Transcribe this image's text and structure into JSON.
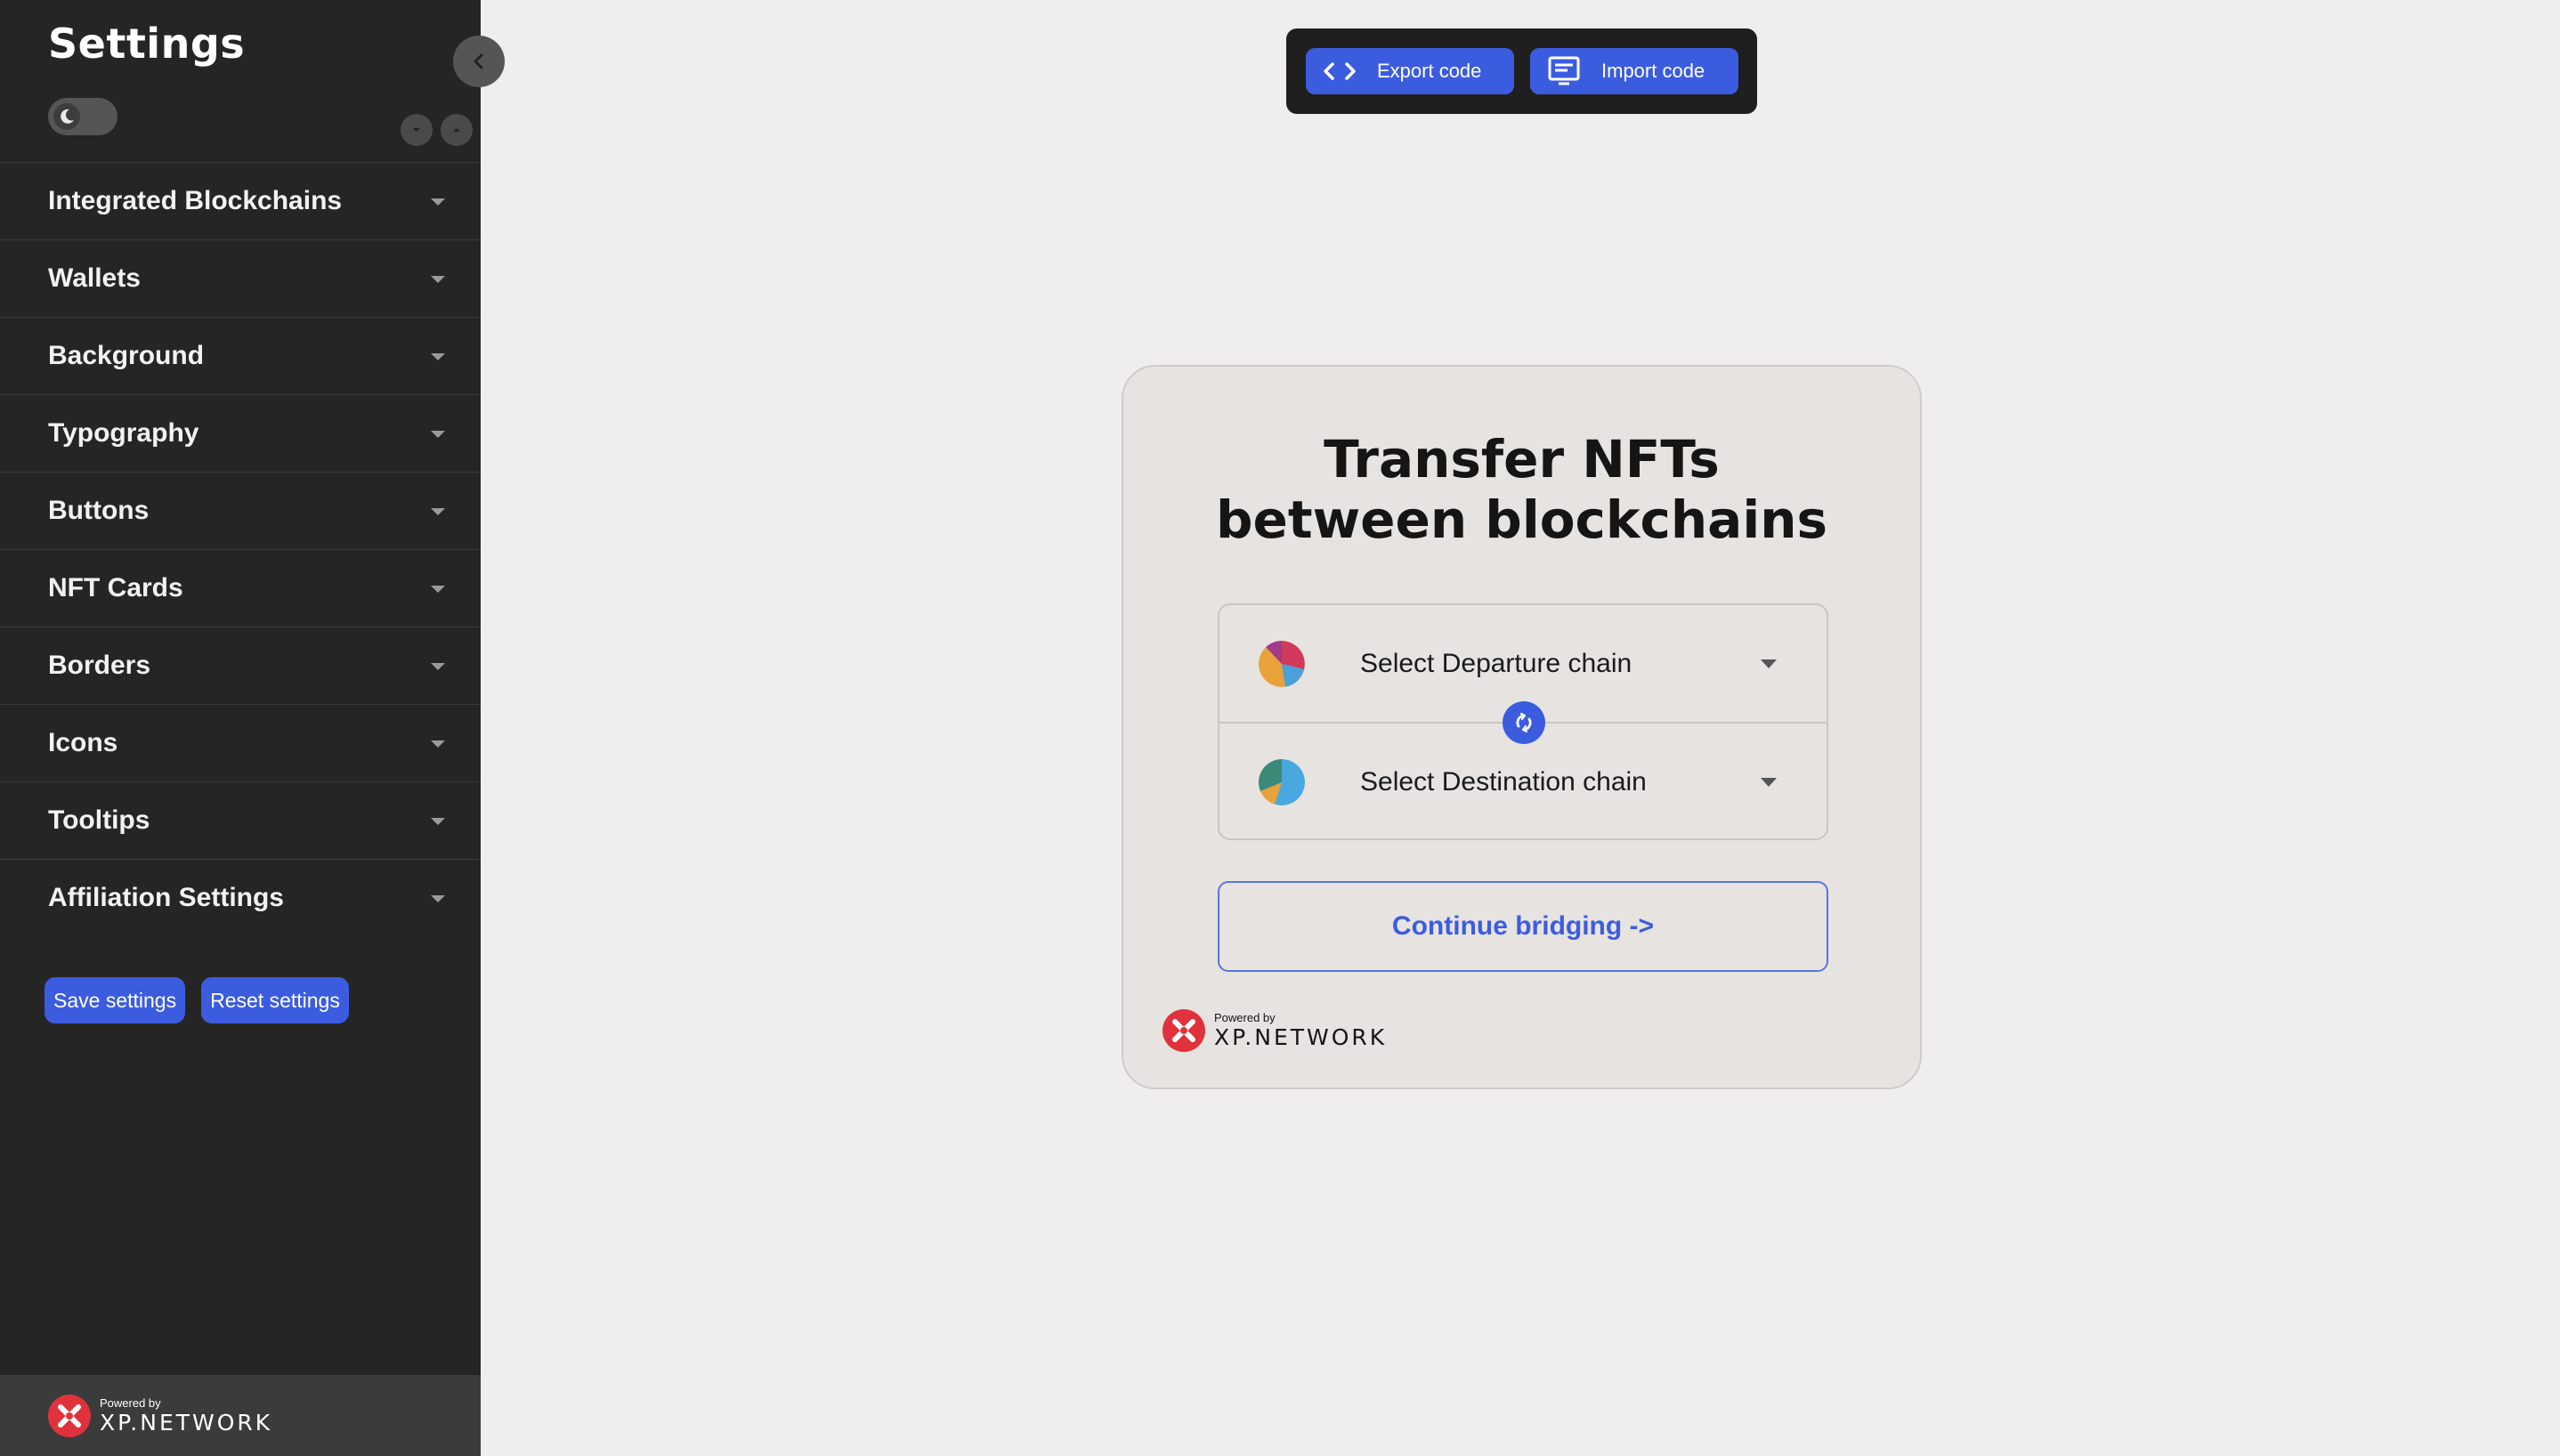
{
  "sidebar": {
    "title": "Settings",
    "theme_toggle_icon": "moon-icon",
    "items": [
      {
        "label": "Integrated Blockchains"
      },
      {
        "label": "Wallets"
      },
      {
        "label": "Background"
      },
      {
        "label": "Typography"
      },
      {
        "label": "Buttons"
      },
      {
        "label": "NFT Cards"
      },
      {
        "label": "Borders"
      },
      {
        "label": "Icons"
      },
      {
        "label": "Tooltips"
      },
      {
        "label": "Affiliation Settings"
      }
    ],
    "save_label": "Save settings",
    "reset_label": "Reset settings",
    "footer": {
      "powered": "Powered by",
      "brand": "XP.NETWORK"
    }
  },
  "toolbar": {
    "export_label": "Export code",
    "import_label": "Import code"
  },
  "card": {
    "title_line1": "Transfer NFTs",
    "title_line2": "between blockchains",
    "departure_placeholder": "Select Departure chain",
    "destination_placeholder": "Select Destination chain",
    "continue_label": "Continue bridging ->",
    "footer": {
      "powered": "Powered by",
      "brand": "XP.NETWORK"
    }
  },
  "colors": {
    "accent": "#3c5ce0",
    "sidebar_bg": "#252525",
    "page_bg": "#efeeed",
    "card_bg": "#e6e3e1",
    "brand_red": "#e0323c"
  }
}
